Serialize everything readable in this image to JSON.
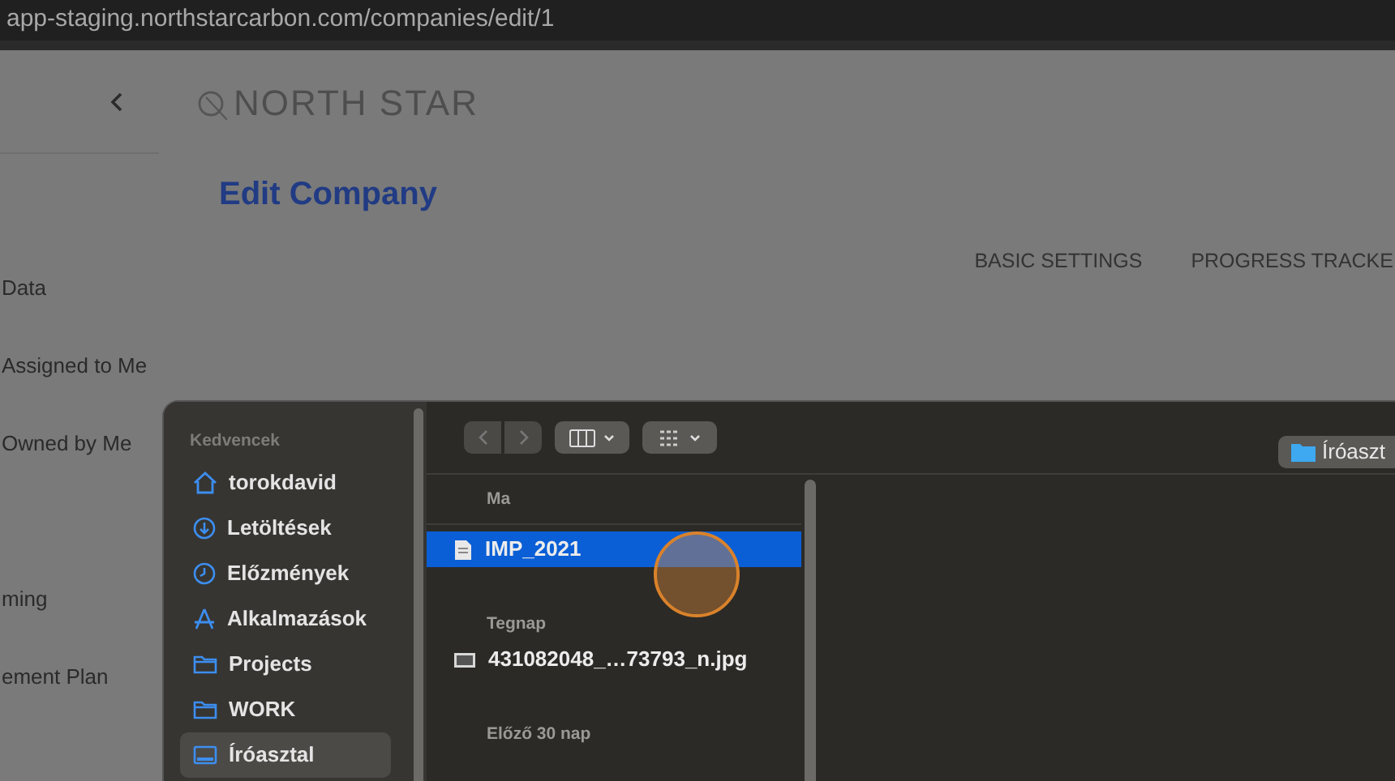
{
  "browser": {
    "url": "app-staging.northstarcarbon.com/companies/edit/1"
  },
  "page": {
    "logo": "NORTH STAR",
    "title": "Edit Company",
    "sidebar_items": [
      {
        "label": "Data"
      },
      {
        "label": "Assigned to Me"
      },
      {
        "label": "Owned by Me"
      },
      {
        "label": "ming"
      },
      {
        "label": "ement Plan"
      }
    ],
    "tabs": [
      {
        "label": "BASIC SETTINGS",
        "selected": false
      },
      {
        "label": "PROGRESS TRACKE",
        "selected": false
      }
    ]
  },
  "dialog": {
    "sidebar": {
      "heading": "Kedvencek",
      "items": [
        {
          "label": "torokdavid",
          "kind": "home",
          "selected": false
        },
        {
          "label": "Letöltések",
          "kind": "download",
          "selected": false
        },
        {
          "label": "Előzmények",
          "kind": "clock",
          "selected": false
        },
        {
          "label": "Alkalmazások",
          "kind": "apps",
          "selected": false
        },
        {
          "label": "Projects",
          "kind": "folder",
          "selected": false
        },
        {
          "label": "WORK",
          "kind": "folder",
          "selected": false
        },
        {
          "label": "Íróasztal",
          "kind": "desktop",
          "selected": true
        }
      ]
    },
    "location": "Íróaszt",
    "groups": [
      {
        "heading": "Ma",
        "files": [
          {
            "name": "IMP_2021",
            "kind": "document",
            "selected": true
          }
        ]
      },
      {
        "heading": "Tegnap",
        "files": [
          {
            "name": "431082048_…73793_n.jpg",
            "kind": "image",
            "selected": false
          }
        ]
      },
      {
        "heading": "Előző 30 nap"
      }
    ]
  }
}
